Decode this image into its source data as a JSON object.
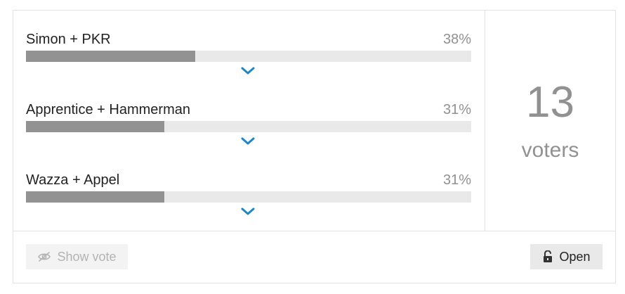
{
  "poll": {
    "options": [
      {
        "name": "Simon + PKR",
        "percent_label": "38%",
        "percent": 38
      },
      {
        "name": "Apprentice + Hammerman",
        "percent_label": "31%",
        "percent": 31
      },
      {
        "name": "Wazza + Appel",
        "percent_label": "31%",
        "percent": 31
      }
    ],
    "voters": {
      "count": "13",
      "label": "voters"
    },
    "footer": {
      "show_vote_label": "Show vote",
      "open_label": "Open"
    },
    "colors": {
      "bar_fill": "#929292",
      "bar_track": "#e9e9e9",
      "chevron": "#1b87c9",
      "muted_text": "#919191"
    },
    "icons": {
      "expand": "chevron-down-icon",
      "hidden": "eye-slash-icon",
      "lock": "unlock-icon"
    }
  }
}
